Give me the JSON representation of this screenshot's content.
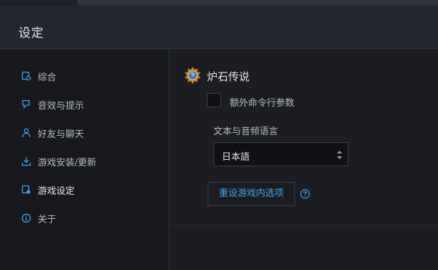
{
  "header": {
    "title": "设定"
  },
  "sidebar": {
    "items": [
      {
        "label": "综合",
        "icon": "general-settings-icon"
      },
      {
        "label": "音效与提示",
        "icon": "sound-notification-icon"
      },
      {
        "label": "好友与聊天",
        "icon": "friends-icon"
      },
      {
        "label": "游戏安装/更新",
        "icon": "download-icon"
      },
      {
        "label": "游戏设定",
        "icon": "game-settings-icon",
        "active": true
      },
      {
        "label": "关于",
        "icon": "info-icon"
      }
    ]
  },
  "main": {
    "game": {
      "name": "炉石传说",
      "icon": "hearthstone-logo-icon"
    },
    "extra_args": {
      "label": "额外命令行参数",
      "checked": false
    },
    "language": {
      "label": "文本与音频语言",
      "value": "日本語"
    },
    "reset_button": {
      "label": "重设游戏内选项"
    },
    "help_icon": "help-icon"
  },
  "colors": {
    "accent": "#3ea6f2",
    "header_bg": "#23262e",
    "sidebar_bg": "#16181d",
    "main_bg": "#1b1d23"
  }
}
